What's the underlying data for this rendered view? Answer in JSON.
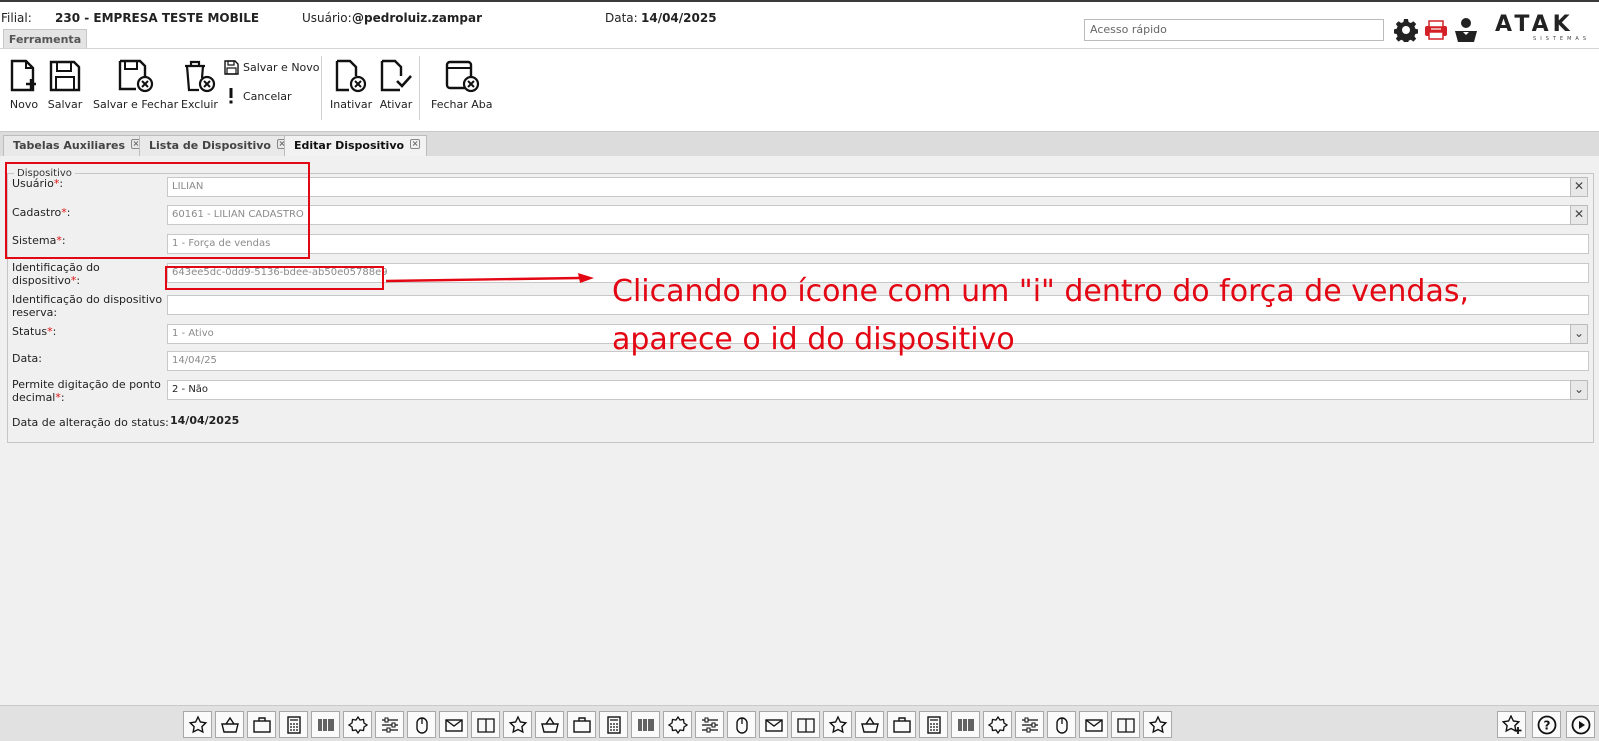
{
  "header": {
    "filial_label": "Filial:",
    "filial_value": "230 - EMPRESA TESTE MOBILE",
    "usuario_label": "Usuário:",
    "usuario_value": "@pedroluiz.zampar",
    "data_label": "Data:",
    "data_value": "14/04/2025",
    "quick_access_placeholder": "Acesso rápido",
    "logo_text": "ATAK",
    "logo_sub": "SISTEMAS"
  },
  "ribbon": {
    "tab_label": "Ferramenta",
    "buttons": [
      {
        "label": "Novo",
        "icon": "new-doc-icon"
      },
      {
        "label": "Salvar",
        "icon": "floppy-icon"
      },
      {
        "label": "Salvar e Fechar",
        "icon": "save-close-icon"
      },
      {
        "label": "Excluir",
        "icon": "trash-icon"
      },
      {
        "label": "Inativar",
        "icon": "doc-x-icon"
      },
      {
        "label": "Ativar",
        "icon": "doc-check-icon"
      },
      {
        "label": "Fechar Aba",
        "icon": "close-tab-icon"
      }
    ],
    "small_buttons": [
      {
        "label": "Salvar e Novo",
        "icon": "save-small-icon"
      },
      {
        "label": "Cancelar",
        "icon": "exclamation-icon"
      }
    ]
  },
  "tabs": [
    {
      "label": "Tabelas Auxiliares",
      "active": false
    },
    {
      "label": "Lista de Dispositivo",
      "active": false
    },
    {
      "label": "Editar Dispositivo",
      "active": true
    }
  ],
  "form": {
    "legend": "Dispositivo",
    "fields": {
      "usuario": {
        "label": "Usuário",
        "required": "*",
        "value": "LILIAN"
      },
      "cadastro": {
        "label": "Cadastro",
        "required": "*",
        "value": "60161 - LILIAN CADASTRO"
      },
      "sistema": {
        "label": "Sistema",
        "required": "*",
        "value": "1 - Força de vendas"
      },
      "identificacao": {
        "label_1": "Identificação do",
        "label_2": "dispositivo",
        "required": "*",
        "value": "643ee5dc-0dd9-5136-bdee-ab50e05788e9"
      },
      "identificacao_reserva": {
        "label_1": "Identificação do dispositivo",
        "label_2": "reserva:",
        "value": ""
      },
      "status": {
        "label": "Status",
        "required": "*",
        "value": "1 - Ativo"
      },
      "data": {
        "label": "Data:",
        "value": "14/04/25"
      },
      "permite": {
        "label_1": "Permite digitação de ponto",
        "label_2": "decimal",
        "required": "*",
        "value": "2 - Não"
      },
      "data_alteracao": {
        "label": "Data de alteração do status:",
        "value": "14/04/2025"
      }
    },
    "colon": ":"
  },
  "annotation": {
    "text": "Clicando no ícone com um \"i\" dentro do força de vendas, aparece o id do dispositivo"
  },
  "colors": {
    "annotation_red": "#e30613",
    "brand_dark": "#222222",
    "header_icon_red": "#d32027"
  },
  "bottom_bar": {
    "icons": [
      "star-icon",
      "basket-icon",
      "briefcase-icon",
      "calculator-icon",
      "barcode-icon",
      "badge-icon",
      "sliders-icon",
      "mouse-icon",
      "envelope-icon",
      "book-icon",
      "box-icon",
      "globe-icon",
      "tower-icon",
      "truck-money-icon",
      "coins-icon",
      "printer-icon",
      "tools-icon",
      "factory-icon",
      "bottle-icon",
      "delivery-truck-icon",
      "arrows-cross-icon",
      "screen-money-icon",
      "document-icon",
      "handshake-icon",
      "hat-icon",
      "helmet-icon",
      "helmet-2-icon",
      "cart-icon",
      "calculator-2-icon",
      "headset-icon",
      "packages-icon"
    ],
    "right_icons": [
      "star-add-icon",
      "help-icon",
      "play-icon"
    ]
  }
}
